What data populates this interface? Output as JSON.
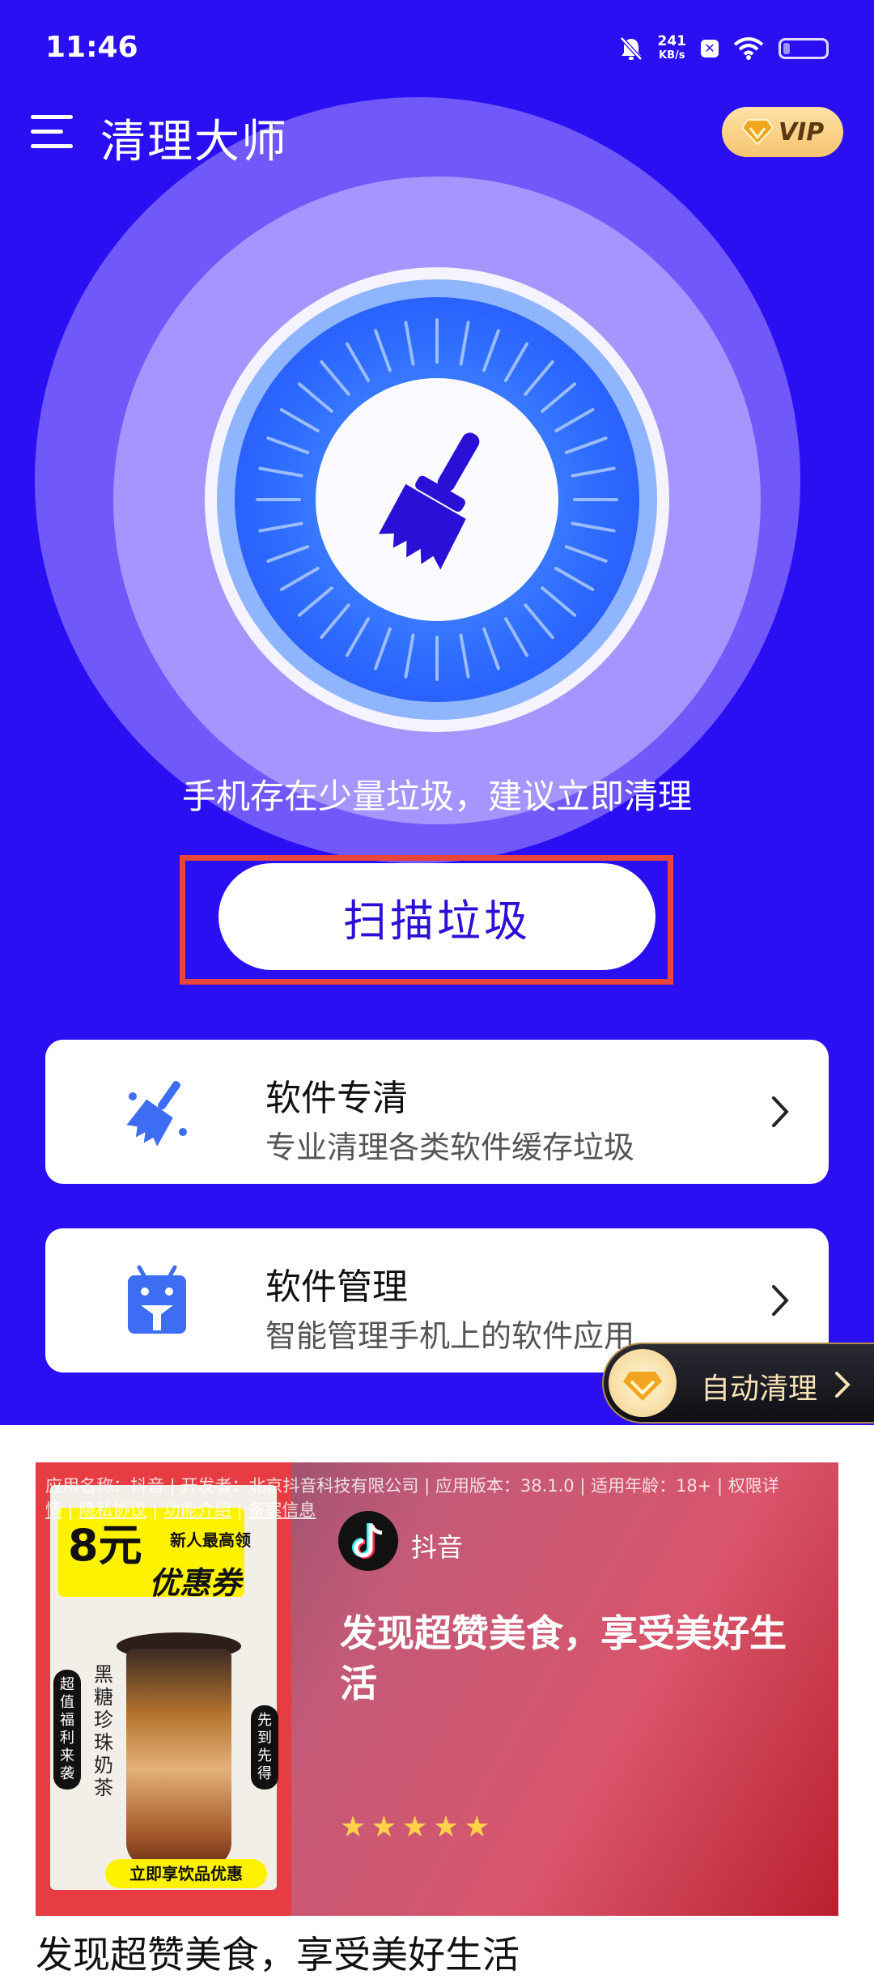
{
  "status_bar": {
    "time": "11:46",
    "net_speed_value": "241",
    "net_speed_unit": "KB/s",
    "battery_level": 0.15
  },
  "header": {
    "title": "清理大师",
    "vip_label": "VIP"
  },
  "main": {
    "hint": "手机存在少量垃圾，建议立即清理",
    "scan_button": "扫描垃圾"
  },
  "cards": [
    {
      "title": "软件专清",
      "subtitle": "专业清理各类软件缓存垃圾",
      "icon": "broom-icon"
    },
    {
      "title": "软件管理",
      "subtitle": "智能管理手机上的软件应用",
      "icon": "android-icon"
    }
  ],
  "floating": {
    "auto_clean_label": "自动清理"
  },
  "ad": {
    "meta_line": "应用名称：抖音 | 开发者：北京抖音科技有限公司 | 应用版本：38.1.0 | 适用年龄：18+ | 权限详",
    "meta_links": [
      "情",
      "隐私协议",
      "功能介绍",
      "备案信息"
    ],
    "brand": "抖音",
    "headline": "发现超赞美食，享受美好生活",
    "rating_stars": "★★★★★",
    "coupon_price": "8元",
    "coupon_new": "新人最高领",
    "coupon_label": "优惠券",
    "drink_name": "黑糖珍珠奶茶",
    "side_left": "超值福利来袭",
    "side_right": "先到先得",
    "buy_label": "立即享饮品优惠",
    "caption": "发现超赞美食，享受美好生活"
  },
  "colors": {
    "primary": "#2a0ff3",
    "scan_highlight": "#e8453c",
    "vip_gold": "#f6c46f"
  }
}
